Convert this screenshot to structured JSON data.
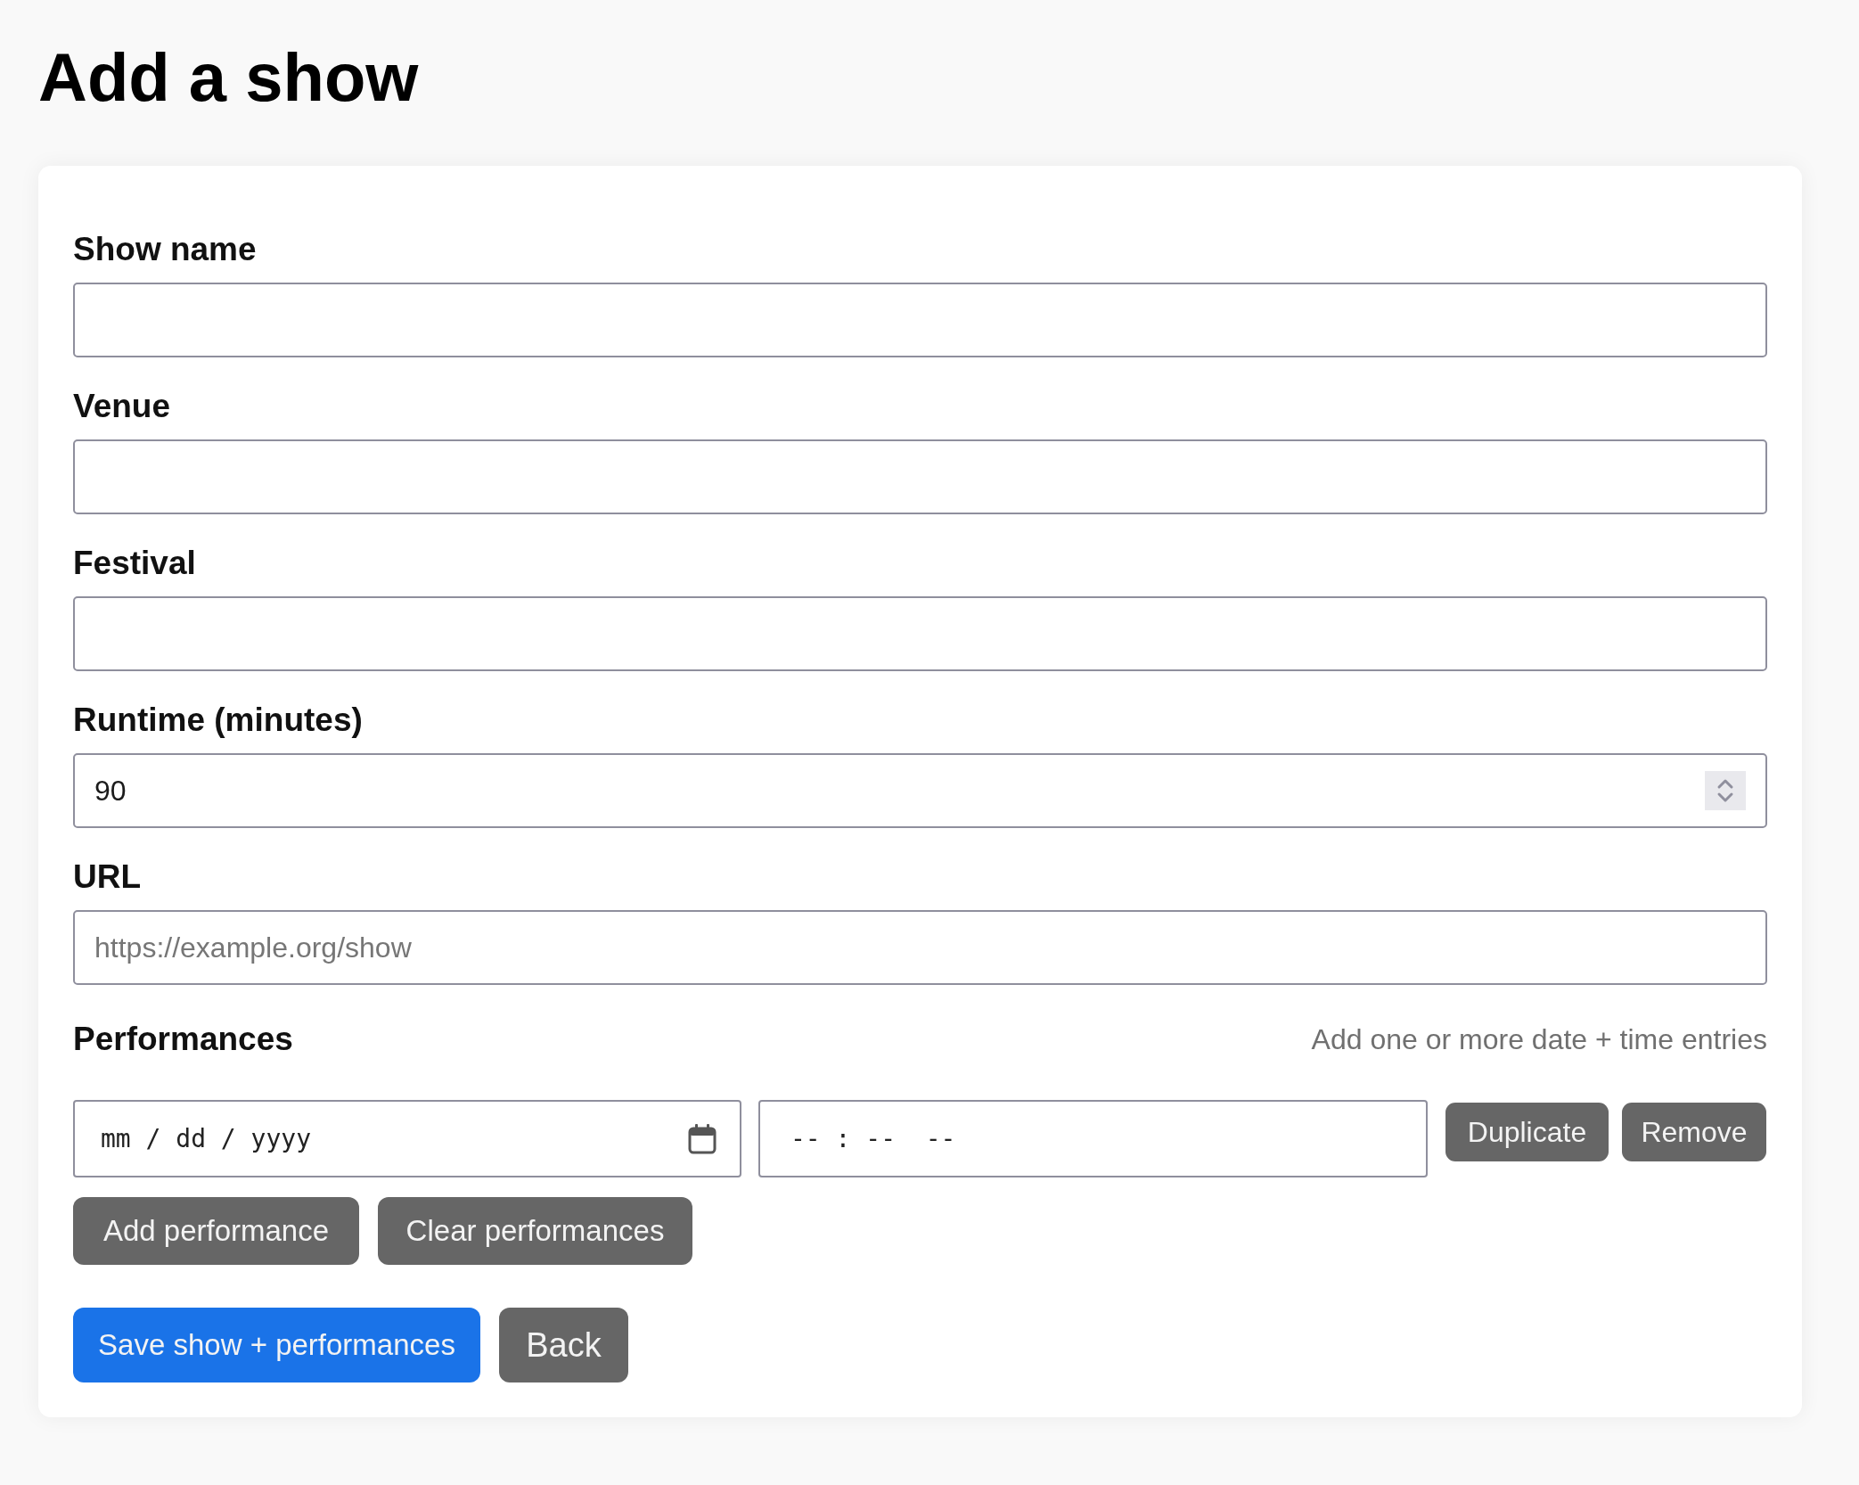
{
  "page": {
    "title": "Add a show"
  },
  "fields": [
    {
      "label": "Show name",
      "kind": "text"
    },
    {
      "label": "Venue",
      "kind": "text"
    },
    {
      "label": "Festival",
      "kind": "text"
    },
    {
      "label": "Runtime (minutes)",
      "kind": "number",
      "value": "90"
    },
    {
      "label": "URL",
      "kind": "text",
      "placeholder": "https://example.org/show"
    }
  ],
  "performances": {
    "heading": "Performances",
    "hint": "Add one or more date + time entries",
    "rows": [
      {
        "date_placeholder": "mm / dd / yyyy",
        "time_placeholder": "-- : --  --",
        "actions": [
          "Duplicate",
          "Remove"
        ]
      }
    ],
    "buttons": [
      "Add performance",
      "Clear performances"
    ]
  },
  "actions": [
    {
      "label": "Save show + performances",
      "kind": "primary"
    },
    {
      "label": "Back",
      "kind": "secondary"
    }
  ]
}
